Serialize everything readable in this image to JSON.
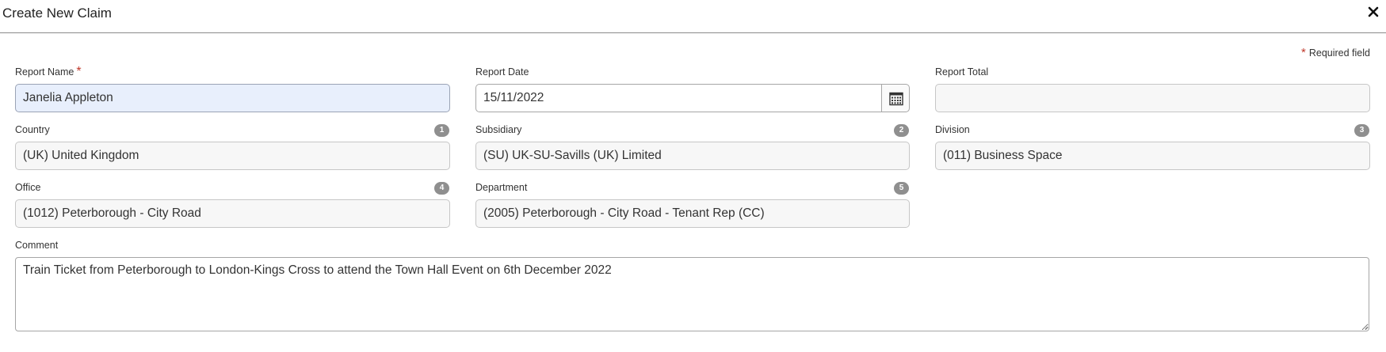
{
  "dialog": {
    "title": "Create New Claim"
  },
  "required_note": {
    "star": "*",
    "text": "Required field"
  },
  "fields": {
    "report_name": {
      "label": "Report Name",
      "star": "*",
      "value": "Janelia Appleton"
    },
    "report_date": {
      "label": "Report Date",
      "value": "15/11/2022"
    },
    "report_total": {
      "label": "Report Total",
      "value": ""
    },
    "country": {
      "label": "Country",
      "badge": "1",
      "value": "(UK) United Kingdom"
    },
    "subsidiary": {
      "label": "Subsidiary",
      "badge": "2",
      "value": "(SU) UK-SU-Savills (UK) Limited"
    },
    "division": {
      "label": "Division",
      "badge": "3",
      "value": "(011) Business Space"
    },
    "office": {
      "label": "Office",
      "badge": "4",
      "value": "(1012) Peterborough - City Road"
    },
    "department": {
      "label": "Department",
      "badge": "5",
      "value": "(2005) Peterborough - City Road - Tenant Rep (CC)"
    },
    "comment": {
      "label": "Comment",
      "value": "Train Ticket from Peterborough to London-Kings Cross to attend the Town Hall Event on 6th December 2022"
    }
  },
  "icons": {
    "close": "close-icon",
    "calendar": "calendar-icon"
  },
  "colors": {
    "required_star": "#c0392b",
    "active_field": "#e8effc",
    "badge": "#8f8f8f"
  }
}
